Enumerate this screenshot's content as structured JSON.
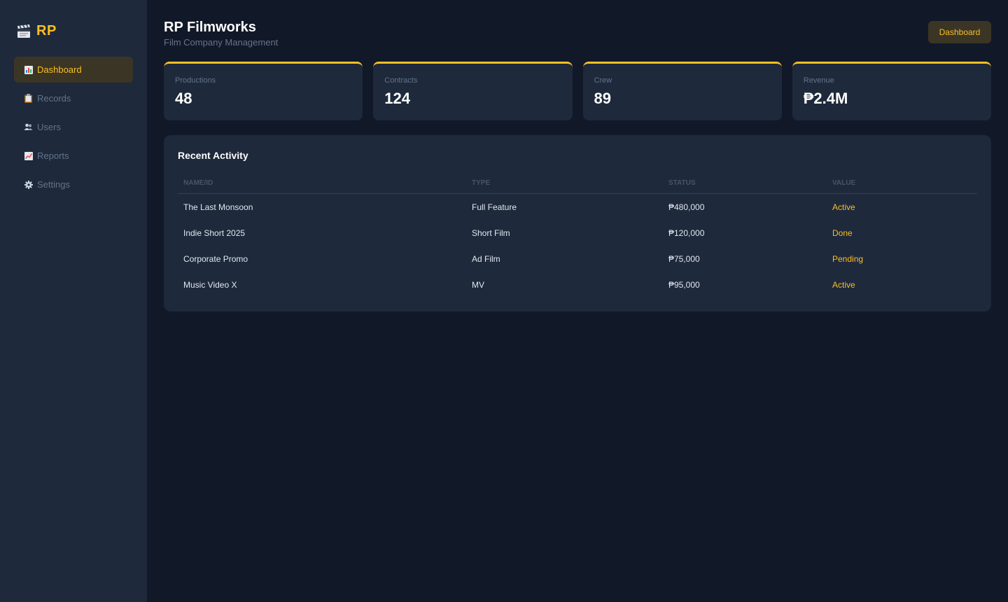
{
  "brand": {
    "name": "RP",
    "icon": "clapperboard-icon"
  },
  "sidebar": {
    "items": [
      {
        "label": "Dashboard",
        "icon": "bar-chart-icon",
        "active": true
      },
      {
        "label": "Records",
        "icon": "clipboard-icon",
        "active": false
      },
      {
        "label": "Users",
        "icon": "users-icon",
        "active": false
      },
      {
        "label": "Reports",
        "icon": "trend-chart-icon",
        "active": false
      },
      {
        "label": "Settings",
        "icon": "gear-icon",
        "active": false
      }
    ]
  },
  "header": {
    "title": "RP Filmworks",
    "subtitle": "Film Company Management",
    "button_label": "Dashboard"
  },
  "stats": [
    {
      "label": "Productions",
      "value": "48"
    },
    {
      "label": "Contracts",
      "value": "124"
    },
    {
      "label": "Crew",
      "value": "89"
    },
    {
      "label": "Revenue",
      "value": "₱2.4M"
    }
  ],
  "activity": {
    "title": "Recent Activity",
    "columns": [
      "Name/ID",
      "Type",
      "Status",
      "Value"
    ],
    "rows": [
      {
        "name": "The Last Monsoon",
        "type": "Full Feature",
        "status": "₱480,000",
        "value": "Active"
      },
      {
        "name": "Indie Short 2025",
        "type": "Short Film",
        "status": "₱120,000",
        "value": "Done"
      },
      {
        "name": "Corporate Promo",
        "type": "Ad Film",
        "status": "₱75,000",
        "value": "Pending"
      },
      {
        "name": "Music Video X",
        "type": "MV",
        "status": "₱95,000",
        "value": "Active"
      }
    ]
  },
  "colors": {
    "accent": "#fbbf24",
    "background": "#111827",
    "panel": "#1e293b",
    "muted": "#64748b"
  }
}
